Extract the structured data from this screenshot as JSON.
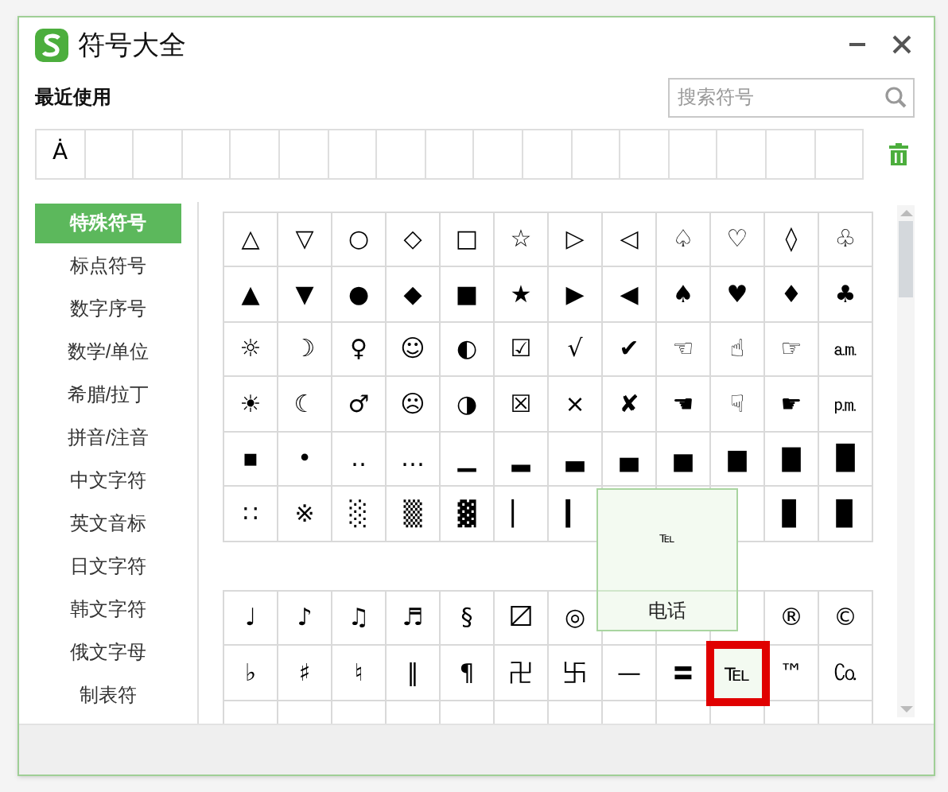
{
  "window": {
    "title": "符号大全"
  },
  "recent": {
    "label": "最近使用",
    "symbols": [
      "Ȧ"
    ]
  },
  "search": {
    "placeholder": "搜索符号"
  },
  "sidebar": {
    "items": [
      {
        "label": "特殊符号",
        "selected": true
      },
      {
        "label": "标点符号",
        "selected": false
      },
      {
        "label": "数字序号",
        "selected": false
      },
      {
        "label": "数学/单位",
        "selected": false
      },
      {
        "label": "希腊/拉丁",
        "selected": false
      },
      {
        "label": "拼音/注音",
        "selected": false
      },
      {
        "label": "中文字符",
        "selected": false
      },
      {
        "label": "英文音标",
        "selected": false
      },
      {
        "label": "日文字符",
        "selected": false
      },
      {
        "label": "韩文字符",
        "selected": false
      },
      {
        "label": "俄文字母",
        "selected": false
      },
      {
        "label": "制表符",
        "selected": false
      }
    ]
  },
  "grids": [
    {
      "rows": [
        [
          {
            "s": "△",
            "selected": false
          },
          {
            "s": "▽",
            "selected": false
          },
          {
            "s": "○",
            "selected": false
          },
          {
            "s": "◇",
            "selected": false
          },
          {
            "s": "□",
            "selected": false
          },
          {
            "s": "☆",
            "selected": false
          },
          {
            "s": "▷",
            "selected": false
          },
          {
            "s": "◁",
            "selected": false
          },
          {
            "s": "♤",
            "selected": false
          },
          {
            "s": "♡",
            "selected": false
          },
          {
            "s": "◊",
            "selected": false
          },
          {
            "s": "♧",
            "selected": false
          }
        ],
        [
          {
            "s": "▲",
            "selected": false
          },
          {
            "s": "▼",
            "selected": false
          },
          {
            "s": "●",
            "selected": false
          },
          {
            "s": "◆",
            "selected": false
          },
          {
            "s": "■",
            "selected": false
          },
          {
            "s": "★",
            "selected": false
          },
          {
            "s": "▶",
            "selected": false
          },
          {
            "s": "◀",
            "selected": false
          },
          {
            "s": "♠",
            "selected": false
          },
          {
            "s": "♥",
            "selected": false
          },
          {
            "s": "♦",
            "selected": false
          },
          {
            "s": "♣",
            "selected": false
          }
        ],
        [
          {
            "s": "☼",
            "selected": false
          },
          {
            "s": "☽",
            "selected": false
          },
          {
            "s": "♀",
            "selected": false
          },
          {
            "s": "☺",
            "selected": false
          },
          {
            "s": "◐",
            "selected": false
          },
          {
            "s": "☑",
            "selected": false
          },
          {
            "s": "√",
            "selected": false
          },
          {
            "s": "✔",
            "selected": false
          },
          {
            "s": "☜",
            "selected": false
          },
          {
            "s": "☝",
            "selected": false
          },
          {
            "s": "☞",
            "selected": false
          },
          {
            "s": "㏂",
            "selected": false
          }
        ],
        [
          {
            "s": "☀",
            "selected": false
          },
          {
            "s": "☾",
            "selected": false
          },
          {
            "s": "♂",
            "selected": false
          },
          {
            "s": "☹",
            "selected": false
          },
          {
            "s": "◑",
            "selected": false
          },
          {
            "s": "☒",
            "selected": false
          },
          {
            "s": "×",
            "selected": false
          },
          {
            "s": "✘",
            "selected": false
          },
          {
            "s": "☚",
            "selected": false
          },
          {
            "s": "☟",
            "selected": false
          },
          {
            "s": "☛",
            "selected": false
          },
          {
            "s": "㏘",
            "selected": false
          }
        ],
        [
          {
            "s": "▪",
            "selected": false
          },
          {
            "s": "•",
            "selected": false
          },
          {
            "s": "‥",
            "selected": false
          },
          {
            "s": "…",
            "selected": false
          },
          {
            "s": "▁",
            "selected": false
          },
          {
            "s": "▂",
            "selected": false
          },
          {
            "s": "▃",
            "selected": false
          },
          {
            "s": "▄",
            "selected": false
          },
          {
            "s": "▅",
            "selected": false
          },
          {
            "s": "▆",
            "selected": false
          },
          {
            "s": "▇",
            "selected": false
          },
          {
            "s": "█",
            "selected": false
          }
        ],
        [
          {
            "s": "∷",
            "selected": false
          },
          {
            "s": "※",
            "selected": false
          },
          {
            "s": "░",
            "selected": false
          },
          {
            "s": "▒",
            "selected": false
          },
          {
            "s": "▓",
            "selected": false
          },
          {
            "s": "▏",
            "selected": false
          },
          {
            "s": "▎",
            "selected": false
          },
          null,
          null,
          null,
          {
            "s": "▊",
            "selected": false
          },
          {
            "s": "▉",
            "selected": false
          }
        ]
      ]
    },
    {
      "rows": [
        [
          {
            "s": "♩",
            "selected": false
          },
          {
            "s": "♪",
            "selected": false
          },
          {
            "s": "♫",
            "selected": false
          },
          {
            "s": "♬",
            "selected": false
          },
          {
            "s": "§",
            "selected": false
          },
          {
            "s": "〼",
            "selected": false
          },
          {
            "s": "◎",
            "selected": false
          },
          null,
          null,
          null,
          {
            "s": "®",
            "selected": false
          },
          {
            "s": "©",
            "selected": false
          }
        ],
        [
          {
            "s": "♭",
            "selected": false
          },
          {
            "s": "♯",
            "selected": false
          },
          {
            "s": "♮",
            "selected": false
          },
          {
            "s": "‖",
            "selected": false
          },
          {
            "s": "¶",
            "selected": false
          },
          {
            "s": "卍",
            "selected": false
          },
          {
            "s": "卐",
            "selected": false
          },
          {
            "s": "—",
            "selected": false
          },
          {
            "s": "〓",
            "selected": false
          },
          {
            "s": "℡",
            "selected": true
          },
          {
            "s": "™",
            "selected": false
          },
          {
            "s": "㏇",
            "selected": false
          }
        ]
      ]
    }
  ],
  "tooltip": {
    "symbol": "℡",
    "name": "电话"
  }
}
